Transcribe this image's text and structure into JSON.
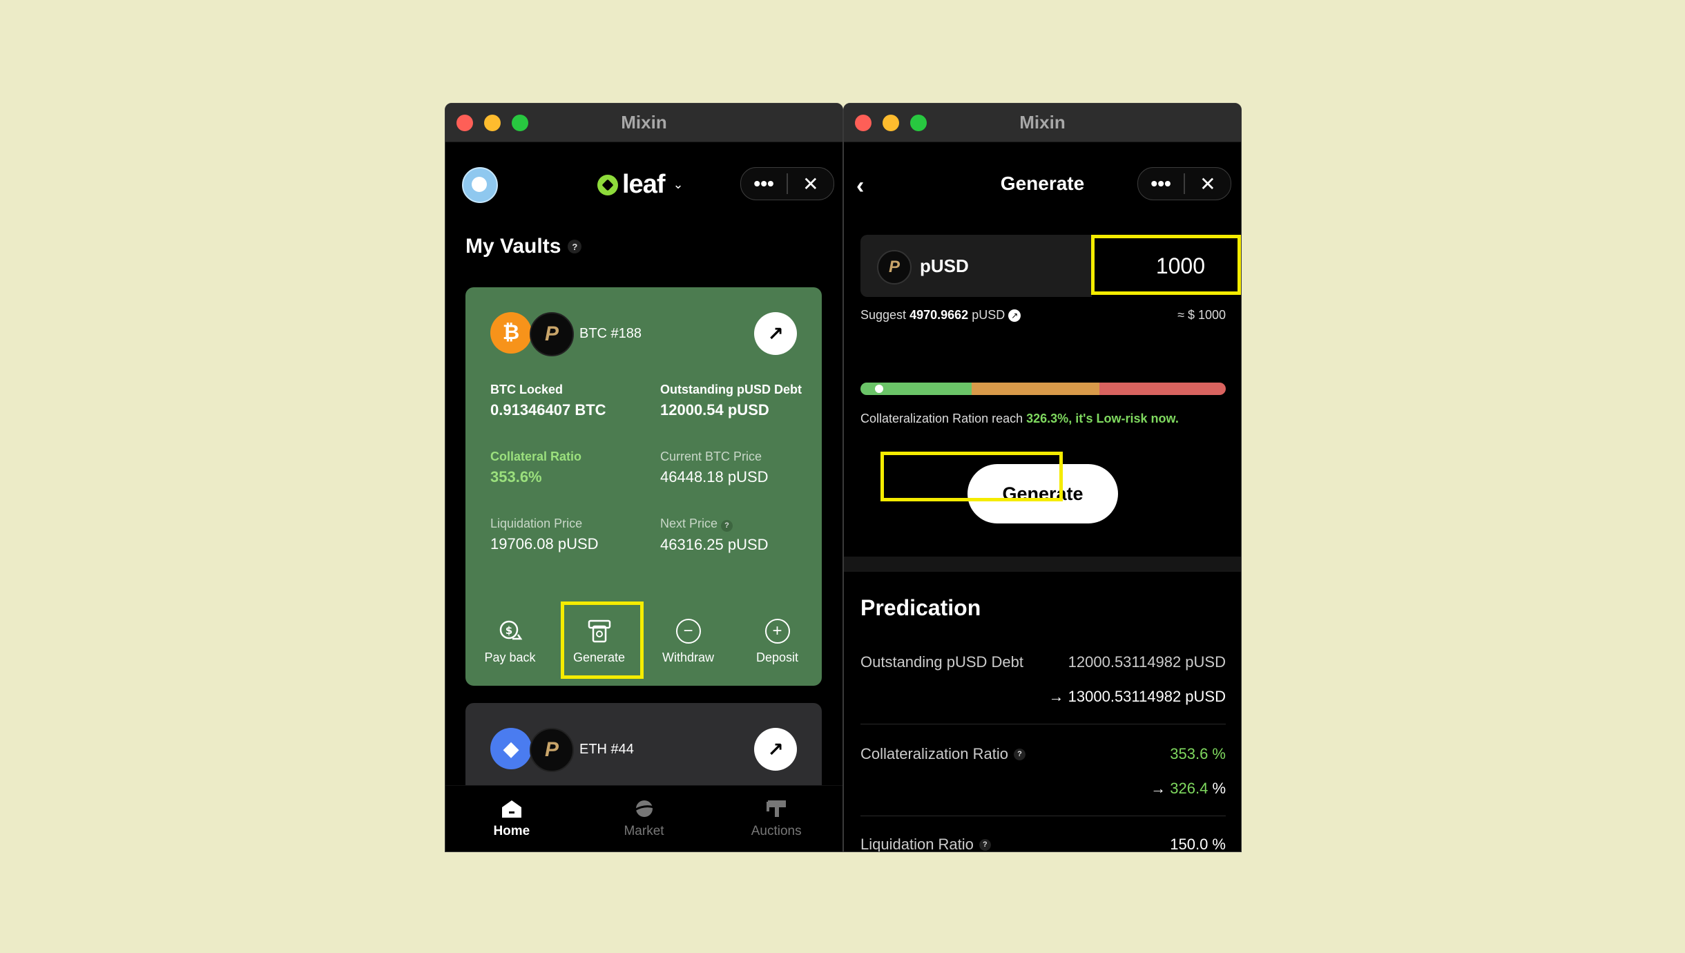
{
  "left_window": {
    "title": "Mixin",
    "brand": "leaf",
    "more_label": "•••",
    "close_label": "✕",
    "section_title": "My Vaults",
    "help_mark": "?",
    "vaults": [
      {
        "name": "BTC #188",
        "coin": "₿",
        "pair_coin": "P",
        "arrow": "↗",
        "btc_locked_label": "BTC Locked",
        "btc_locked_value": "0.91346407 BTC",
        "debt_label": "Outstanding pUSD Debt",
        "debt_value": "12000.54 pUSD",
        "ratio_label": "Collateral Ratio",
        "ratio_value": "353.6%",
        "price_label": "Current BTC Price",
        "price_value": "46448.18 pUSD",
        "liq_label": "Liquidation Price",
        "liq_value": "19706.08 pUSD",
        "next_label": "Next Price",
        "next_value": "46316.25 pUSD"
      },
      {
        "name": "ETH #44",
        "coin": "◆",
        "pair_coin": "P",
        "arrow": "↗"
      }
    ],
    "actions": {
      "payback": "Pay back",
      "generate": "Generate",
      "withdraw": "Withdraw",
      "deposit": "Deposit"
    },
    "nav": {
      "home": "Home",
      "market": "Market",
      "auctions": "Auctions"
    }
  },
  "right_window": {
    "title": "Mixin",
    "back": "‹",
    "header": "Generate",
    "more_label": "•••",
    "close_label": "✕",
    "asset": {
      "coin": "P",
      "name": "pUSD",
      "amount": "1000"
    },
    "suggest": {
      "prefix": "Suggest",
      "value": "4970.9662",
      "unit": "pUSD",
      "icon": "↗"
    },
    "approx": "≈ $ 1000",
    "risk_position_pct": 4,
    "risk_text_prefix": "Collateralization Ration reach",
    "risk_text_highlight": "326.3%, it's Low-risk now.",
    "generate_button": "Generate",
    "predication": {
      "title": "Predication",
      "debt_label": "Outstanding pUSD Debt",
      "debt_from": "12000.53114982 pUSD",
      "debt_to": "→ 13000.53114982 pUSD",
      "ratio_label": "Collateralization Ratio",
      "ratio_from": "353.6 %",
      "ratio_to_arrow": "→",
      "ratio_to": "326.4",
      "ratio_to_pct": "%",
      "liq_label": "Liquidation Ratio",
      "liq_value": "150.0 %",
      "help_mark": "?"
    }
  },
  "colors": {
    "background": "#ecebc7",
    "vault_green": "#4c7c50",
    "highlight": "#f5ec00",
    "accent_green": "#7fd95f"
  }
}
